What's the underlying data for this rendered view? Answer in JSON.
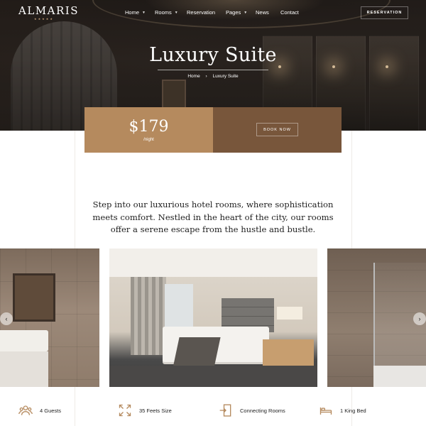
{
  "brand": {
    "name": "ALMARIS",
    "stars": "★★★★★"
  },
  "nav": {
    "items": [
      {
        "label": "Home",
        "dropdown": true
      },
      {
        "label": "Rooms",
        "dropdown": true
      },
      {
        "label": "Reservation",
        "dropdown": false
      },
      {
        "label": "Pages",
        "dropdown": true
      },
      {
        "label": "News",
        "dropdown": false
      },
      {
        "label": "Contact",
        "dropdown": false
      }
    ],
    "reservation_button": "RESERVATION"
  },
  "hero": {
    "title": "Luxury Suite",
    "breadcrumb": {
      "home": "Home",
      "separator": "›",
      "current": "Luxury Suite"
    }
  },
  "pricing": {
    "price": "$179",
    "period": "/night",
    "book_button": "BOOK NOW"
  },
  "intro": "Step into our luxurious hotel rooms, where sophistication meets comfort. Nestled in the heart of the city, our rooms offer a serene escape from the hustle and bustle.",
  "gallery": {
    "prev_icon": "‹",
    "next_icon": "›",
    "photos": [
      "bathroom-vanity",
      "bedroom",
      "walk-in-shower"
    ]
  },
  "features": [
    {
      "icon": "guests-icon",
      "label": "4 Guests"
    },
    {
      "icon": "expand-icon",
      "label": "35 Feets Size"
    },
    {
      "icon": "connecting-door-icon",
      "label": "Connecting Rooms"
    },
    {
      "icon": "bed-icon",
      "label": "1 King Bed"
    }
  ],
  "colors": {
    "accent": "#b58a5e",
    "accent_dark": "#78563b",
    "hero_dark": "#2b2420"
  }
}
